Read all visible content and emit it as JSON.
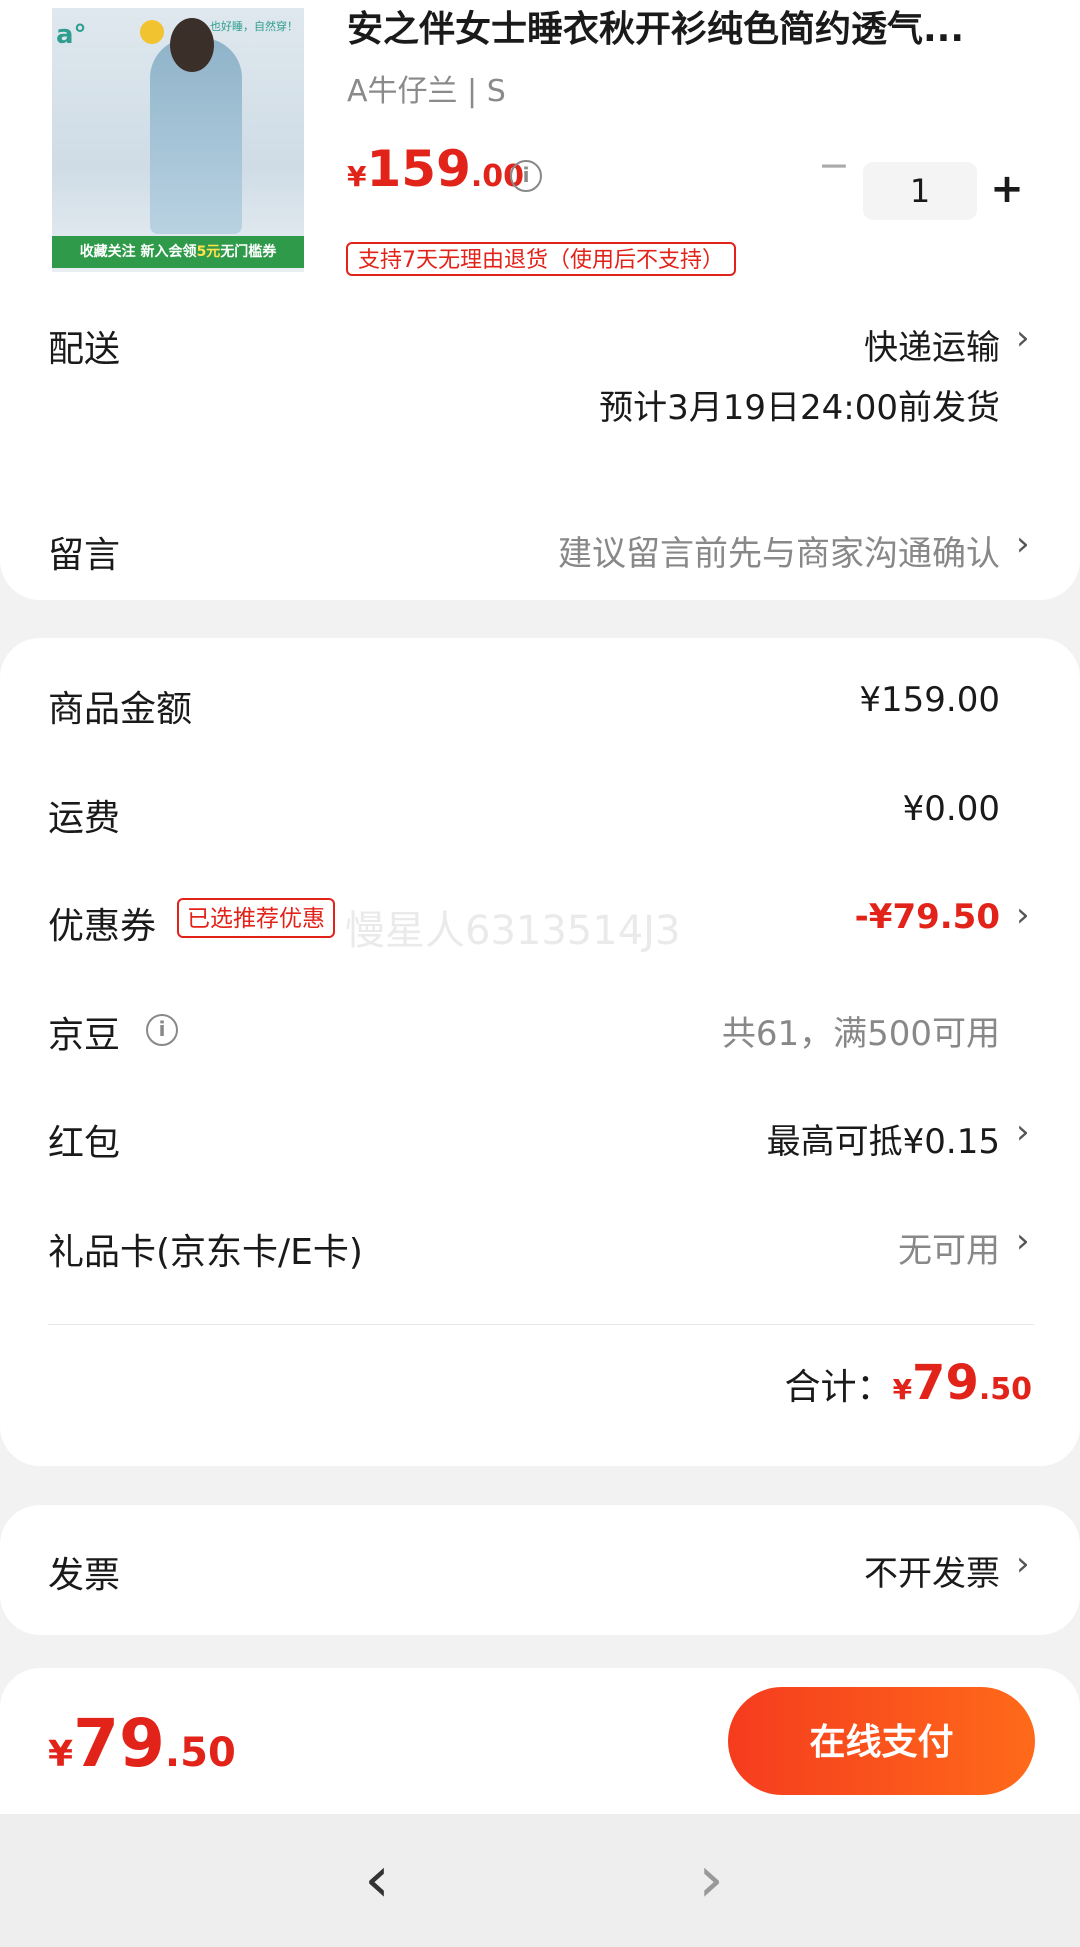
{
  "product": {
    "title": "安之伴女士睡衣秋开衫纯色简约透气...",
    "spec": "A牛仔兰 | S",
    "price": {
      "currency": "¥",
      "integer": "159",
      "decimal": ".00"
    },
    "quantity": "1",
    "return_badge": "支持7天无理由退货（使用后不支持）",
    "image": {
      "brand": "a°",
      "slogan": "也好睡，自然穿！",
      "strip_text_a": "收藏关注  新入会领",
      "strip_highlight": "5元",
      "strip_text_b": "无门槛券"
    }
  },
  "delivery": {
    "label": "配送",
    "method": "快递运输",
    "eta": "预计3月19日24:00前发货"
  },
  "message": {
    "label": "留言",
    "placeholder": "建议留言前先与商家沟通确认"
  },
  "costs": {
    "goods": {
      "label": "商品金额",
      "value": "¥159.00"
    },
    "shipping": {
      "label": "运费",
      "value": "¥0.00"
    },
    "coupon": {
      "label": "优惠券",
      "badge": "已选推荐优惠",
      "value": "-¥79.50"
    },
    "beans": {
      "label": "京豆",
      "value": "共61，满500可用"
    },
    "redpacket": {
      "label": "红包",
      "value": "最高可抵¥0.15"
    },
    "giftcard": {
      "label": "礼品卡(京东卡/E卡)",
      "value": "无可用"
    },
    "total": {
      "label": "合计：",
      "currency": "¥",
      "integer": "79",
      "decimal": ".50"
    }
  },
  "watermark": "慢星人6313514J3",
  "invoice": {
    "label": "发票",
    "value": "不开发票"
  },
  "pay": {
    "currency": "¥",
    "integer": "79",
    "decimal": ".50",
    "button": "在线支付"
  },
  "nav": {
    "back": "‹",
    "forward": "›"
  },
  "icons": {
    "info": "i",
    "chevron": "›",
    "minus": "−",
    "plus": "+"
  },
  "colors": {
    "accent": "#e2231a",
    "button_start": "#f53c1e",
    "button_end": "#ff6a1a"
  }
}
